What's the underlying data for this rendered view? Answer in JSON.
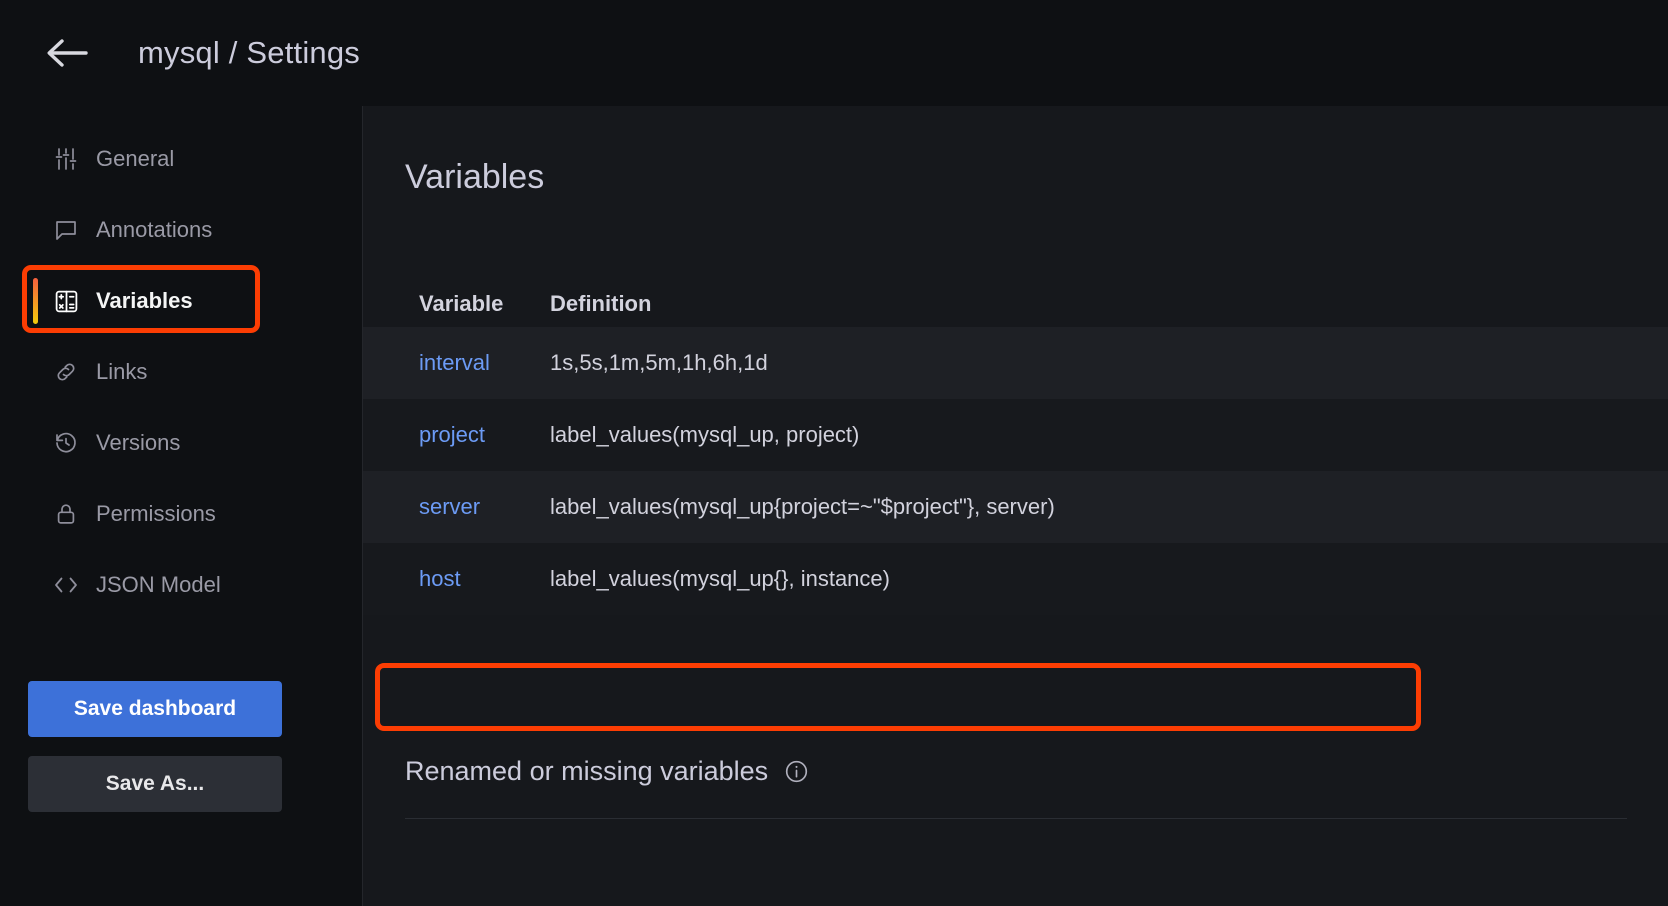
{
  "header": {
    "back_icon": "arrow-left-icon",
    "breadcrumb": "mysql / Settings"
  },
  "sidebar": {
    "items": [
      {
        "label": "General",
        "icon": "sliders-icon",
        "active": false
      },
      {
        "label": "Annotations",
        "icon": "comment-icon",
        "active": false
      },
      {
        "label": "Variables",
        "icon": "calculator-icon",
        "active": true
      },
      {
        "label": "Links",
        "icon": "link-icon",
        "active": false
      },
      {
        "label": "Versions",
        "icon": "history-icon",
        "active": false
      },
      {
        "label": "Permissions",
        "icon": "lock-icon",
        "active": false
      },
      {
        "label": "JSON Model",
        "icon": "code-icon",
        "active": false
      }
    ],
    "save_dashboard_label": "Save dashboard",
    "save_as_label": "Save As..."
  },
  "main": {
    "title": "Variables",
    "table": {
      "columns": [
        "Variable",
        "Definition"
      ],
      "rows": [
        {
          "variable": "interval",
          "definition": "1s,5s,1m,5m,1h,6h,1d"
        },
        {
          "variable": "project",
          "definition": "label_values(mysql_up, project)"
        },
        {
          "variable": "server",
          "definition": "label_values(mysql_up{project=~\"$project\"}, server)"
        },
        {
          "variable": "host",
          "definition": "label_values(mysql_up{}, instance)"
        }
      ]
    },
    "bottom_section": {
      "title": "Renamed or missing variables",
      "info_icon": "info-circle-icon"
    }
  },
  "annotations": {
    "color": "#fc3d03",
    "highlighted_nav_item": "Variables",
    "highlighted_row_variable": "host"
  },
  "colors": {
    "background": "#0e1013",
    "panel": "#16181c",
    "link": "#6c9bf5",
    "primary_button": "#3d71d9",
    "accent_gradient_start": "#f55f3e",
    "accent_gradient_end": "#f2cc0c"
  }
}
